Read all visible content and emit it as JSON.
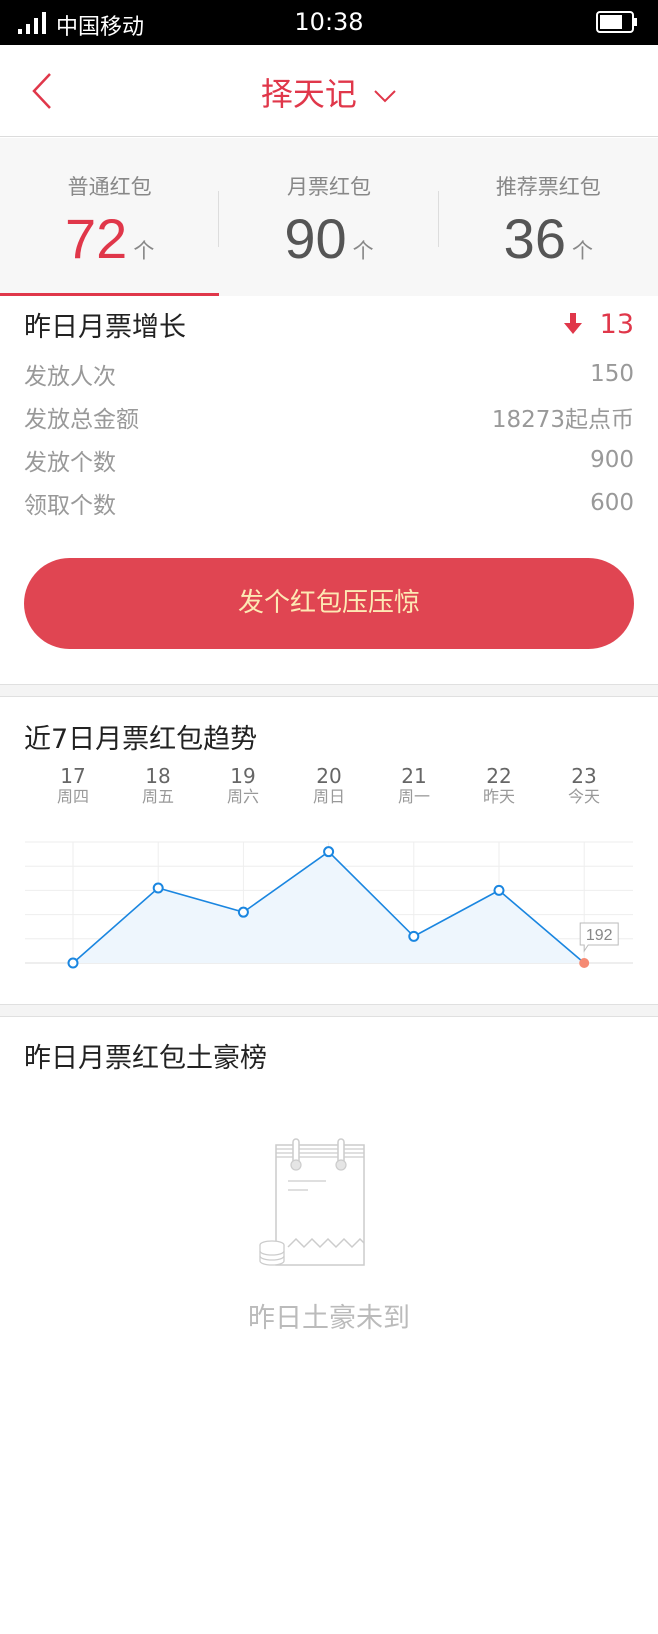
{
  "status_bar": {
    "carrier": "中国移动",
    "time": "10:38",
    "signal_icon": "signal-icon",
    "battery_icon": "battery-icon"
  },
  "nav": {
    "title": "择天记",
    "back_icon": "chevron-left-icon",
    "dropdown_icon": "chevron-down-icon"
  },
  "tabs": [
    {
      "label": "普通红包",
      "value": "72",
      "unit": "个",
      "active": true
    },
    {
      "label": "月票红包",
      "value": "90",
      "unit": "个",
      "active": false
    },
    {
      "label": "推荐票红包",
      "value": "36",
      "unit": "个",
      "active": false
    }
  ],
  "stats": {
    "title": "昨日月票增长",
    "delta": "13",
    "delta_direction": "down",
    "rows": [
      {
        "label": "发放人次",
        "value": "150"
      },
      {
        "label": "发放总金额",
        "value": "18273起点币"
      },
      {
        "label": "发放个数",
        "value": "900"
      },
      {
        "label": "领取个数",
        "value": "600"
      }
    ]
  },
  "cta": {
    "label": "发个红包压压惊"
  },
  "trend": {
    "title": "近7日月票红包趋势",
    "days": [
      {
        "date": "17",
        "weekday": "周四"
      },
      {
        "date": "18",
        "weekday": "周五"
      },
      {
        "date": "19",
        "weekday": "周六"
      },
      {
        "date": "20",
        "weekday": "周日"
      },
      {
        "date": "21",
        "weekday": "周一"
      },
      {
        "date": "22",
        "weekday": "昨天"
      },
      {
        "date": "23",
        "weekday": "今天"
      }
    ]
  },
  "chart_data": {
    "type": "line",
    "title": "近7日月票红包趋势",
    "categories": [
      "17",
      "18",
      "19",
      "20",
      "21",
      "22",
      "23"
    ],
    "values": [
      0,
      3.1,
      2.1,
      4.6,
      1.1,
      3.0,
      0
    ],
    "value_units": "relative grid levels (unlabeled axis)",
    "highlight": {
      "index": 6,
      "label": "192"
    },
    "ylim": [
      0,
      5
    ],
    "grid": true,
    "xlabel": "",
    "ylabel": "",
    "colors": {
      "line": "#1a86e0",
      "fill": "#eef6fd",
      "highlight": "#f58a73",
      "grid": "#eeeeee"
    }
  },
  "rank": {
    "title": "昨日月票红包土豪榜",
    "empty_text": "昨日土豪未到",
    "empty_icon": "notepad-coins-icon"
  },
  "colors": {
    "accent": "#e0374a",
    "cta_bg": "#e04552",
    "cta_text": "#fde9b4"
  }
}
